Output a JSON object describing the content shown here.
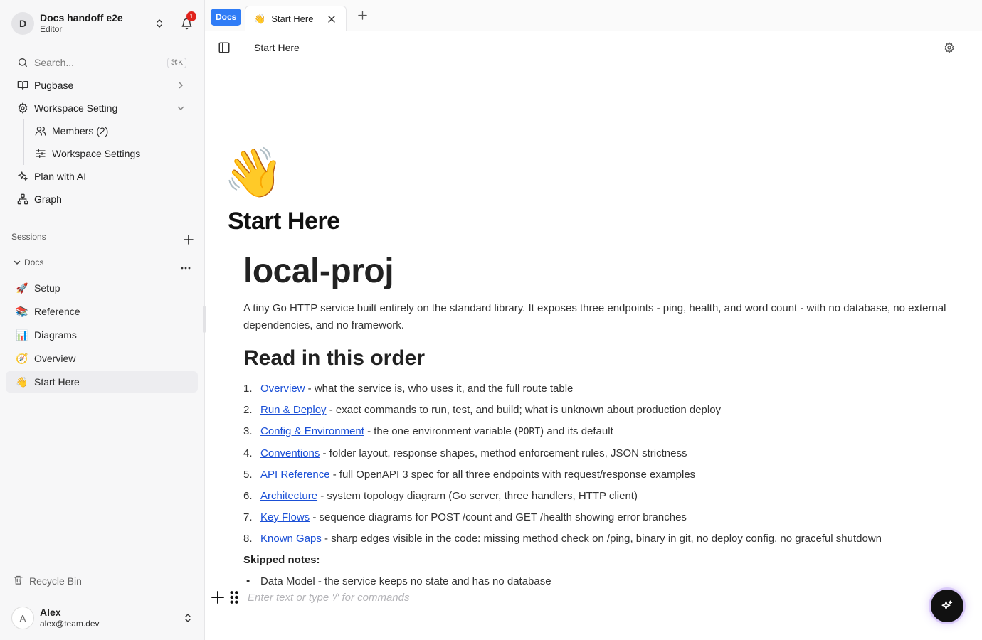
{
  "workspace": {
    "initial": "D",
    "name": "Docs handoff e2e",
    "role": "Editor",
    "notification_count": "1"
  },
  "nav": {
    "search_label": "Search...",
    "search_shortcut": "⌘K",
    "pugbase": "Pugbase",
    "workspace_setting": "Workspace Setting",
    "members": "Members (2)",
    "workspace_settings": "Workspace Settings",
    "plan_ai": "Plan with AI",
    "graph": "Graph"
  },
  "sessions_label": "Sessions",
  "docs_section": {
    "label": "Docs",
    "items": [
      {
        "emoji": "🚀",
        "label": "Setup"
      },
      {
        "emoji": "📚",
        "label": "Reference"
      },
      {
        "emoji": "📊",
        "label": "Diagrams"
      },
      {
        "emoji": "🧭",
        "label": "Overview"
      },
      {
        "emoji": "👋",
        "label": "Start Here"
      }
    ]
  },
  "recycle_bin": "Recycle Bin",
  "user": {
    "initial": "A",
    "name": "Alex",
    "email": "alex@team.dev"
  },
  "tabs": {
    "space_chip": "Docs",
    "active": {
      "emoji": "👋",
      "label": "Start Here"
    }
  },
  "breadcrumb": "Start Here",
  "page": {
    "emoji": "👋",
    "title": "Start Here",
    "h1": "local-proj",
    "intro": "A tiny Go HTTP service built entirely on the standard library. It exposes three endpoints - ping, health, and word count - with no database, no external dependencies, and no framework.",
    "h2": "Read in this order",
    "order": [
      {
        "num": "1.",
        "link": "Overview",
        "text": " - what the service is, who uses it, and the full route table"
      },
      {
        "num": "2.",
        "link": "Run & Deploy",
        "text": " - exact commands to run, test, and build; what is unknown about production deploy"
      },
      {
        "num": "3.",
        "link": "Config & Environment",
        "text_before": " - the one environment variable (",
        "code": "PORT",
        "text_after": ") and its default"
      },
      {
        "num": "4.",
        "link": "Conventions",
        "text": " - folder layout, response shapes, method enforcement rules, JSON strictness"
      },
      {
        "num": "5.",
        "link": "API Reference",
        "text": " - full OpenAPI 3 spec for all three endpoints with request/response examples"
      },
      {
        "num": "6.",
        "link": "Architecture",
        "text": " - system topology diagram (Go server, three handlers, HTTP client)"
      },
      {
        "num": "7.",
        "link": "Key Flows",
        "text": " - sequence diagrams for POST /count and GET /health showing error branches"
      },
      {
        "num": "8.",
        "link": "Known Gaps",
        "text": " - sharp edges visible in the code: missing method check on /ping, binary in git, no deploy config, no graceful shutdown"
      }
    ],
    "skipped_label": "Skipped notes:",
    "skipped": [
      {
        "text": "Data Model - the service keeps no state and has no database"
      }
    ],
    "placeholder": "Enter text or type '/' for commands"
  }
}
